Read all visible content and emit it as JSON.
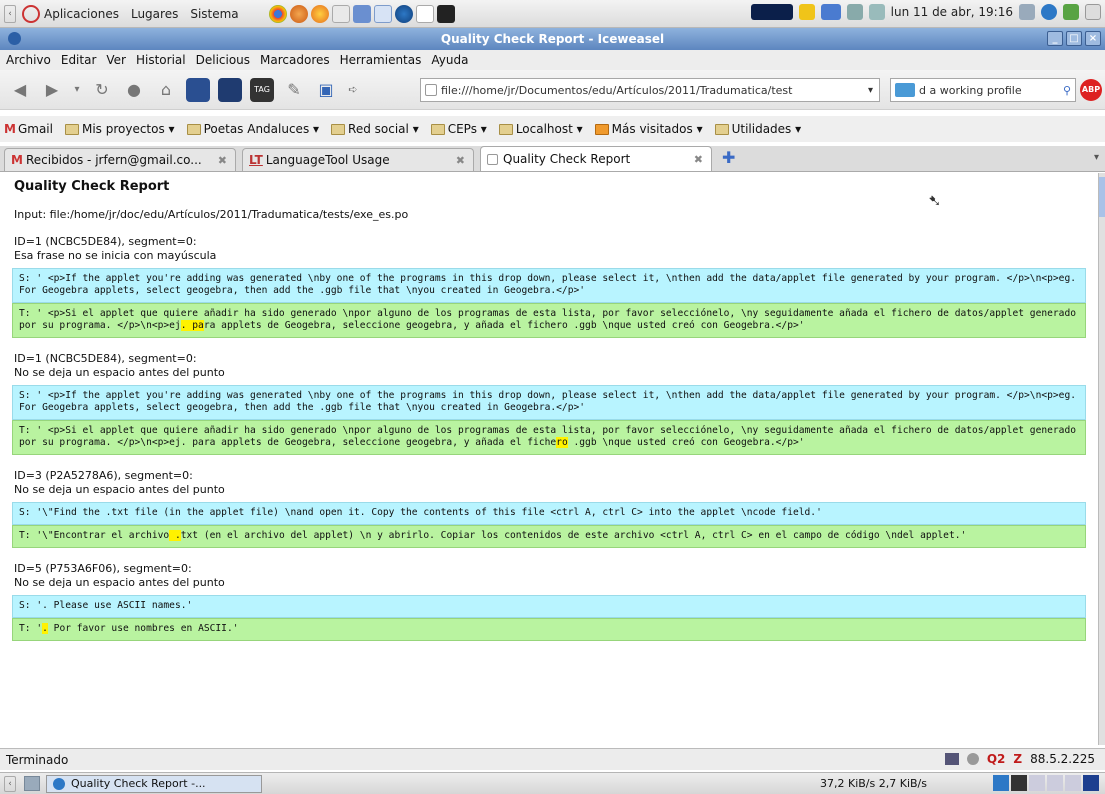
{
  "panel": {
    "menus": [
      "Aplicaciones",
      "Lugares",
      "Sistema"
    ],
    "clock": "lun 11 de abr, 19:16"
  },
  "window": {
    "title": "Quality Check Report - Iceweasel"
  },
  "menubar": [
    "Archivo",
    "Editar",
    "Ver",
    "Historial",
    "Delicious",
    "Marcadores",
    "Herramientas",
    "Ayuda"
  ],
  "navbar": {
    "url": "file:///home/jr/Documentos/edu/Artículos/2011/Tradumatica/test",
    "search": "d a working profile"
  },
  "bookmarks": [
    "Gmail",
    "Mis proyectos",
    "Poetas Andaluces",
    "Red social",
    "CEPs",
    "Localhost",
    "Más visitados",
    "Utilidades"
  ],
  "tabs": [
    {
      "label": "Recibidos - jrfern@gmail.co..."
    },
    {
      "label": "LanguageTool Usage"
    },
    {
      "label": "Quality Check Report"
    }
  ],
  "report": {
    "title": "Quality Check Report",
    "input": "Input: file:/home/jr/doc/edu/Artículos/2011/Tradumatica/tests/exe_es.po",
    "issues": [
      {
        "id": "ID=1 (NCBC5DE84), segment=0:",
        "message": "Esa frase no se inicia con mayúscula",
        "source": "S: ' <p>If the applet you're adding was generated \\nby one of the programs in this drop down, please select it, \\nthen add the data/applet file generated by your program. </p>\\n<p>eg. For Geogebra applets, select geogebra, then add the .ggb file that \\nyou created in Geogebra.</p>'",
        "target_pre": "T: ' <p>Si el applet que quiere añadir ha sido generado \\npor alguno de los programas de esta lista, por favor selecciónelo, \\ny seguidamente añada el fichero de datos/applet generado por su programa. </p>\\n<p>ej",
        "target_hl": ". pa",
        "target_post": "ra applets de Geogebra, seleccione geogebra, y añada el fichero .ggb \\nque usted creó con Geogebra.</p>'"
      },
      {
        "id": "ID=1 (NCBC5DE84), segment=0:",
        "message": "No se deja un espacio antes del punto",
        "source": "S: ' <p>If the applet you're adding was generated \\nby one of the programs in this drop down, please select it, \\nthen add the data/applet file generated by your program. </p>\\n<p>eg. For Geogebra applets, select geogebra, then add the .ggb file that \\nyou created in Geogebra.</p>'",
        "target_pre": "T: ' <p>Si el applet que quiere añadir ha sido generado \\npor alguno de los programas de esta lista, por favor selecciónelo, \\ny seguidamente añada el fichero de datos/applet generado por su programa. </p>\\n<p>ej. para applets de Geogebra, seleccione geogebra, y añada el fiche",
        "target_hl": "ro",
        "target_post": " .ggb \\nque usted creó con Geogebra.</p>'"
      },
      {
        "id": "ID=3 (P2A5278A6), segment=0:",
        "message": "No se deja un espacio antes del punto",
        "source": "S: '\\\"Find the .txt file (in the applet file) \\nand open it. Copy the contents of this file <ctrl A, ctrl C> into the applet \\ncode field.'",
        "target_pre": "T: '\\\"Encontrar el archivo",
        "target_hl": " .",
        "target_post": "txt (en el archivo del applet) \\n y abrirlo. Copiar los contenidos de este archivo <ctrl A, ctrl C> en el campo de código \\ndel applet.'"
      },
      {
        "id": "ID=5 (P753A6F06), segment=0:",
        "message": "No se deja un espacio antes del punto",
        "source": "S: '. Please use ASCII names.'",
        "target_pre": "T: '",
        "target_hl": ".",
        "target_post": " Por favor use nombres en ASCII.'"
      }
    ]
  },
  "statusbar": {
    "text": "Terminado",
    "q_count": "Q2",
    "z": "Z",
    "ip": "88.5.2.225"
  },
  "taskbar": {
    "window": "Quality Check Report -...",
    "net": "37,2 KiB/s  2,7 KiB/s"
  },
  "colors": {
    "source_bg": "#b8f4ff",
    "target_bg": "#b9f3a0",
    "highlight": "#fff200",
    "titlebar": "#6d93c8"
  }
}
